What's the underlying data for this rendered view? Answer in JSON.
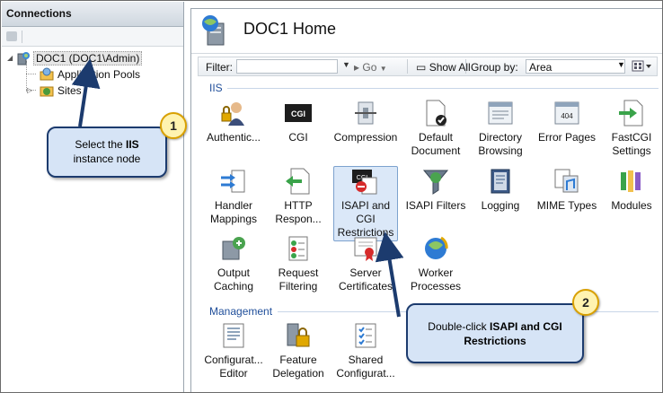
{
  "connections": {
    "header": "Connections",
    "tree": [
      {
        "label": "DOC1 (DOC1\\Admin)",
        "expander": "◢",
        "icon": "server-icon"
      },
      {
        "label": "Application Pools",
        "icon": "app-pools-icon"
      },
      {
        "label": "Sites",
        "expander": "▷",
        "icon": "sites-icon"
      }
    ]
  },
  "main": {
    "title": "DOC1 Home",
    "filter": {
      "label": "Filter:",
      "value": "",
      "go": "Go",
      "show_all": "Show All",
      "group_by_label": "Group by:",
      "group_by_value": "Area"
    },
    "sections": [
      {
        "name": "IIS",
        "features": [
          {
            "label": "Authentic...",
            "icon": "authentication-icon"
          },
          {
            "label": "CGI",
            "icon": "cgi-icon"
          },
          {
            "label": "Compression",
            "icon": "compression-icon"
          },
          {
            "label": "Default\nDocument",
            "icon": "default-document-icon"
          },
          {
            "label": "Directory\nBrowsing",
            "icon": "directory-browsing-icon"
          },
          {
            "label": "Error Pages",
            "icon": "error-pages-icon"
          },
          {
            "label": "FastCGI\nSettings",
            "icon": "fastcgi-icon"
          },
          {
            "label": "Handler\nMappings",
            "icon": "handler-mappings-icon"
          },
          {
            "label": "HTTP\nRespon...",
            "icon": "http-response-icon"
          },
          {
            "label": "ISAPI and\nCGI\nRestrictions",
            "icon": "isapi-cgi-restrictions-icon",
            "selected": true
          },
          {
            "label": "ISAPI Filters",
            "icon": "isapi-filters-icon"
          },
          {
            "label": "Logging",
            "icon": "logging-icon"
          },
          {
            "label": "MIME Types",
            "icon": "mime-types-icon"
          },
          {
            "label": "Modules",
            "icon": "modules-icon"
          },
          {
            "label": "Output\nCaching",
            "icon": "output-caching-icon"
          },
          {
            "label": "Request\nFiltering",
            "icon": "request-filtering-icon"
          },
          {
            "label": "Server\nCertificates",
            "icon": "server-certificates-icon"
          },
          {
            "label": "Worker\nProcesses",
            "icon": "worker-processes-icon"
          }
        ]
      },
      {
        "name": "Management",
        "features": [
          {
            "label": "Configurat...\nEditor",
            "icon": "configuration-editor-icon"
          },
          {
            "label": "Feature\nDelegation",
            "icon": "feature-delegation-icon"
          },
          {
            "label": "Shared\nConfigurat...",
            "icon": "shared-configuration-icon"
          }
        ]
      }
    ]
  },
  "callouts": [
    {
      "number": "1",
      "text_pre": "Select the ",
      "text_bold": "IIS",
      "text_post": " instance node"
    },
    {
      "number": "2",
      "text_pre": "Double-click ",
      "text_bold": "ISAPI and CGI Restrictions",
      "text_post": ""
    }
  ],
  "colors": {
    "section_header": "#1f4e9a",
    "callout_fill": "#d6e4f6",
    "callout_border": "#1c3b6e",
    "badge_fill": "#fff3b0",
    "badge_border": "#d9a000",
    "selection": "#dbe8f8"
  }
}
